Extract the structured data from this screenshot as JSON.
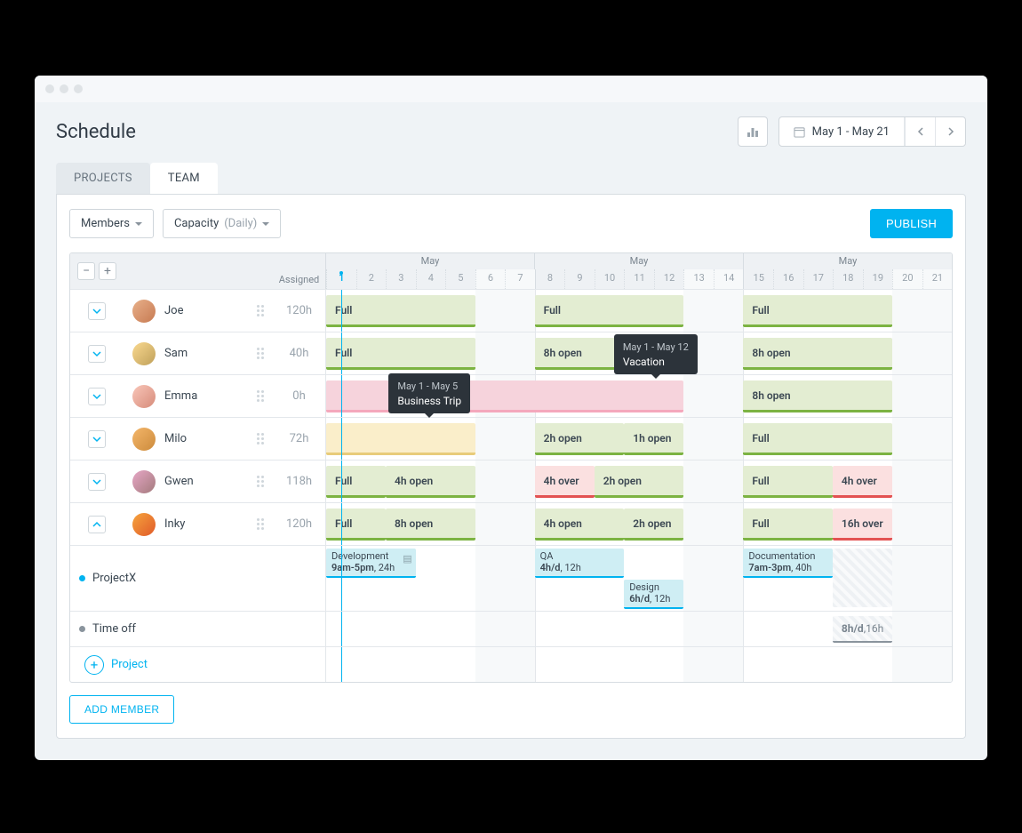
{
  "header": {
    "title": "Schedule",
    "date_range": "May 1 - May 21"
  },
  "tabs": {
    "projects": "PROJECTS",
    "team": "TEAM"
  },
  "toolbar": {
    "members_filter": "Members",
    "capacity_filter_label": "Capacity",
    "capacity_filter_value": "(Daily)",
    "publish": "PUBLISH"
  },
  "grid_head": {
    "assigned_label": "Assigned",
    "month_label": "May",
    "days": [
      "1",
      "2",
      "3",
      "4",
      "5",
      "6",
      "7",
      "8",
      "9",
      "10",
      "11",
      "12",
      "13",
      "14",
      "15",
      "16",
      "17",
      "18",
      "19",
      "20",
      "21"
    ]
  },
  "members": [
    {
      "name": "Joe",
      "assigned": "120h",
      "blocks": {
        "w1": "Full",
        "w2": "Full",
        "w3": "Full"
      }
    },
    {
      "name": "Sam",
      "assigned": "40h",
      "blocks": {
        "w1": "Full",
        "w2": "8h open",
        "w3": "8h open"
      }
    },
    {
      "name": "Emma",
      "assigned": "0h",
      "blocks": {
        "w3": "8h open"
      }
    },
    {
      "name": "Milo",
      "assigned": "72h",
      "blocks": {
        "w2a": "2h open",
        "w2b": "1h open",
        "w3": "Full"
      }
    },
    {
      "name": "Gwen",
      "assigned": "118h",
      "blocks": {
        "w1a": "Full",
        "w1b": "4h open",
        "w2a": "4h over",
        "w2b": "2h open",
        "w3a": "Full",
        "w3b": "4h over"
      }
    },
    {
      "name": "Inky",
      "assigned": "120h",
      "blocks": {
        "w1a": "Full",
        "w1b": "8h open",
        "w2a": "4h open",
        "w2b": "2h open",
        "w3a": "Full",
        "w3b": "16h over"
      }
    }
  ],
  "tooltips": {
    "trip": {
      "dates": "May 1 - May 5",
      "label": "Business Trip"
    },
    "vacation": {
      "dates": "May 1 - May 12",
      "label": "Vacation"
    }
  },
  "inky_tasks": {
    "dev": {
      "title": "Development",
      "time": "9am-5pm",
      "dur": "24h"
    },
    "qa": {
      "title": "QA",
      "time": "4h/d",
      "dur": "12h"
    },
    "design": {
      "title": "Design",
      "time": "6h/d",
      "dur": "12h"
    },
    "doc": {
      "title": "Documentation",
      "time": "7am-3pm",
      "dur": "40h"
    }
  },
  "projects": {
    "projectx": "ProjectX",
    "timeoff": "Time off",
    "timeoff_block": {
      "time": "8h/d",
      "dur": "16h"
    },
    "add_project": "Project"
  },
  "footer": {
    "add_member": "ADD MEMBER"
  }
}
